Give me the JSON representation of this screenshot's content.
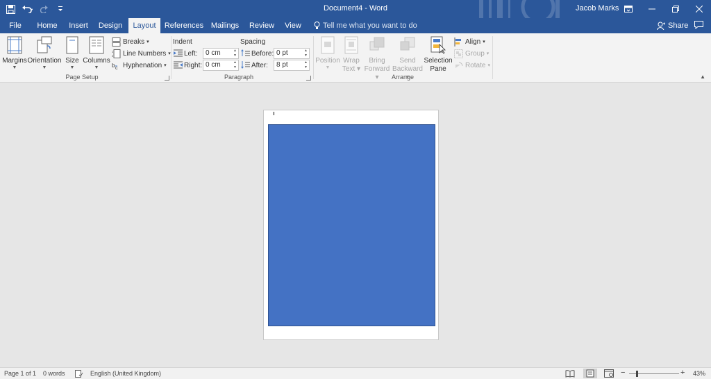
{
  "window": {
    "title": "Document4 - Word",
    "user": "Jacob Marks"
  },
  "quick_access": {
    "save_icon": "save-icon",
    "undo_icon": "undo-icon",
    "redo_icon": "redo-icon",
    "customize_icon": "customize-qat-icon"
  },
  "tabs": [
    {
      "label": "File"
    },
    {
      "label": "Home"
    },
    {
      "label": "Insert"
    },
    {
      "label": "Design"
    },
    {
      "label": "Layout"
    },
    {
      "label": "References"
    },
    {
      "label": "Mailings"
    },
    {
      "label": "Review"
    },
    {
      "label": "View"
    }
  ],
  "active_tab": "Layout",
  "tell_me": "Tell me what you want to do",
  "share": "Share",
  "ribbon": {
    "page_setup": {
      "label": "Page Setup",
      "margins": "Margins",
      "orientation": "Orientation",
      "size": "Size",
      "columns": "Columns",
      "breaks": "Breaks",
      "line_numbers": "Line Numbers",
      "hyphenation": "Hyphenation"
    },
    "paragraph": {
      "label": "Paragraph",
      "indent": "Indent",
      "spacing": "Spacing",
      "left_label": "Left:",
      "left_value": "0 cm",
      "right_label": "Right:",
      "right_value": "0 cm",
      "before_label": "Before:",
      "before_value": "0 pt",
      "after_label": "After:",
      "after_value": "8 pt"
    },
    "arrange": {
      "label": "Arrange",
      "position": "Position",
      "wrap_text_1": "Wrap",
      "wrap_text_2": "Text",
      "bring_forward_1": "Bring",
      "bring_forward_2": "Forward",
      "send_backward_1": "Send",
      "send_backward_2": "Backward",
      "selection_pane_1": "Selection",
      "selection_pane_2": "Pane",
      "align": "Align",
      "group": "Group",
      "rotate": "Rotate"
    }
  },
  "status": {
    "page": "Page 1 of 1",
    "words": "0 words",
    "language": "English (United Kingdom)",
    "zoom": "43%",
    "zoom_minus": "−",
    "zoom_plus": "+"
  },
  "colors": {
    "brand": "#2b579a",
    "shape_fill": "#4472c4"
  }
}
